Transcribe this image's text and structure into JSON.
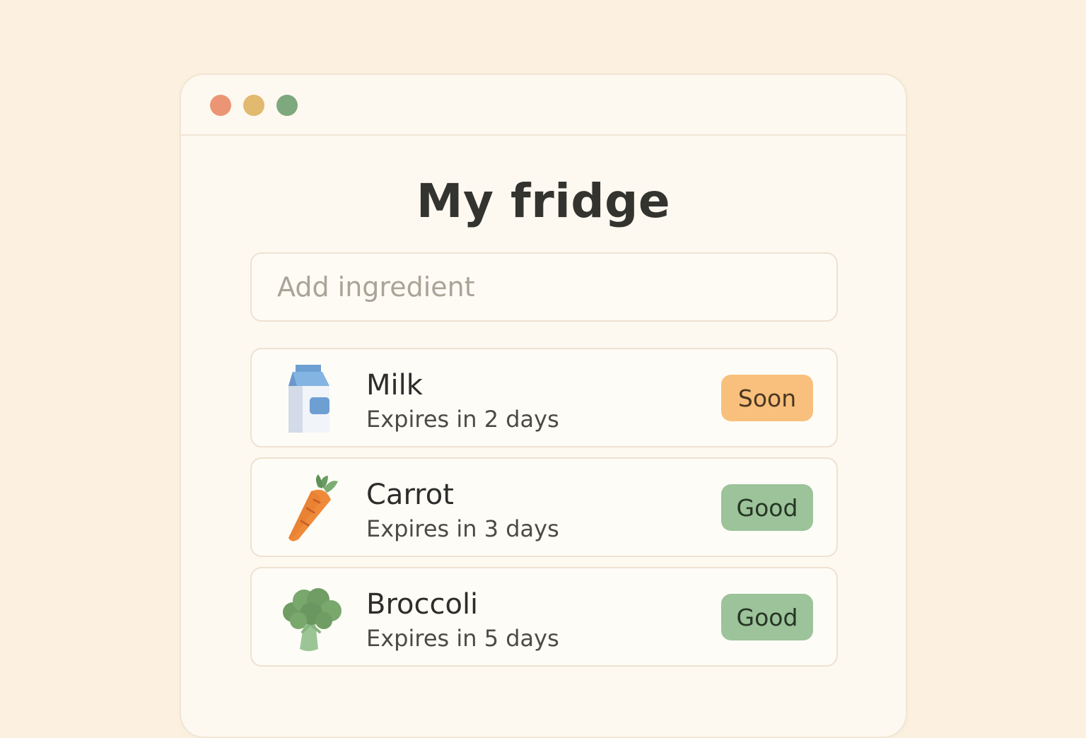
{
  "window": {
    "controls": [
      "close",
      "minimize",
      "maximize"
    ]
  },
  "page_title": "My fridge",
  "add_input": {
    "placeholder": "Add ingredient",
    "value": ""
  },
  "items": [
    {
      "name": "Milk",
      "expiry": "Expires in 2 days",
      "status": "Soon",
      "icon": "milk-carton-icon",
      "status_color": "#f8c07c"
    },
    {
      "name": "Carrot",
      "expiry": "Expires in 3 days",
      "status": "Good",
      "icon": "carrot-icon",
      "status_color": "#9cc39a"
    },
    {
      "name": "Broccoli",
      "expiry": "Expires in 5 days",
      "status": "Good",
      "icon": "broccoli-icon",
      "status_color": "#9cc39a"
    }
  ],
  "colors": {
    "background": "#fcf1e0",
    "window": "#fdf9f1",
    "close": "#ec9575",
    "minimize": "#e1b96f",
    "maximize": "#7ea87d"
  }
}
